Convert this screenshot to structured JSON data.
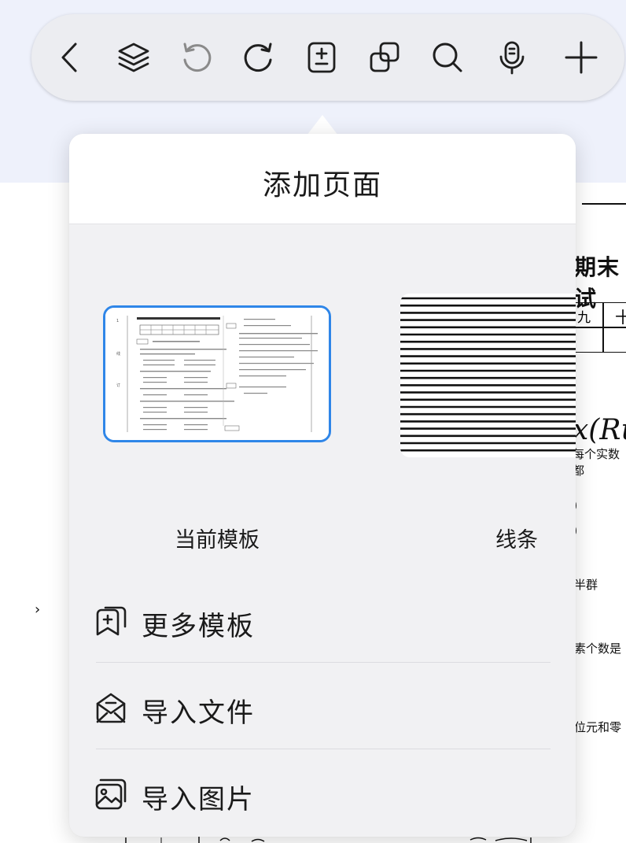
{
  "toolbar": {
    "buttons": [
      {
        "name": "back",
        "icon": "chevron-left-icon"
      },
      {
        "name": "layers",
        "icon": "layers-icon"
      },
      {
        "name": "undo",
        "icon": "undo-icon"
      },
      {
        "name": "redo",
        "icon": "redo-icon"
      },
      {
        "name": "add-page",
        "icon": "add-page-icon"
      },
      {
        "name": "duplicate",
        "icon": "duplicate-icon"
      },
      {
        "name": "search",
        "icon": "search-icon"
      },
      {
        "name": "microphone",
        "icon": "microphone-icon"
      },
      {
        "name": "add",
        "icon": "plus-icon"
      }
    ]
  },
  "popover": {
    "title": "添加页面",
    "templates": [
      {
        "label": "当前模板",
        "selected": true
      },
      {
        "label": "线条",
        "selected": false
      }
    ],
    "menu": [
      {
        "label": "更多模板",
        "icon": "template-add-icon"
      },
      {
        "label": "导入文件",
        "icon": "import-file-icon"
      },
      {
        "label": "导入图片",
        "icon": "import-image-icon"
      }
    ]
  },
  "background_doc": {
    "title_fragment": "期末试",
    "table_cells": [
      "九",
      "十"
    ],
    "handwritten": "x(Ru",
    "subtext": "每个实数都",
    "paren_1": ")",
    "paren_2": ")",
    "semigroup": "半群",
    "element_count": "素个数是",
    "identity": "位元和零",
    "left_mark": "›"
  },
  "colors": {
    "accent": "#2f86e8",
    "toolbar_bg": "#ecedf1",
    "top_band": "#eef1fb",
    "popover_bg": "#f1f1f3"
  }
}
